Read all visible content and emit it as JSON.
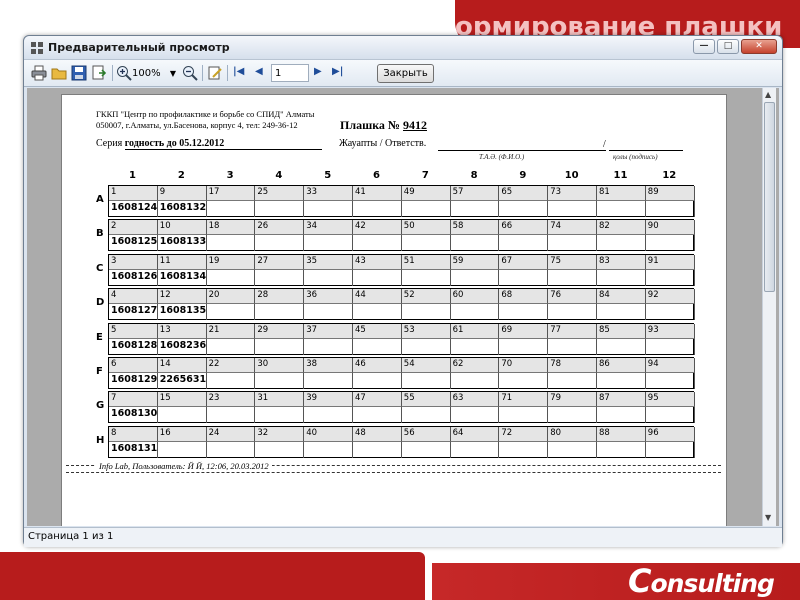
{
  "slide": {
    "header_text": "ормирование плашки",
    "logo_letter": "C",
    "logo_text": "onsulting"
  },
  "window": {
    "title": "Предварительный просмотр",
    "minimize_symbol": "—",
    "maximize_symbol": "□",
    "close_symbol": "✕"
  },
  "toolbar": {
    "zoom": "100%",
    "page_value": "1",
    "close_label": "Закрыть"
  },
  "status": {
    "text": "Страница 1 из 1"
  },
  "report": {
    "org_line1": "ГККП \"Центр по профилактике и борьбе со СПИД\" Алматы",
    "org_line2": "050007, г.Алматы, ул.Басенова, корпус 4, тел: 249-36-12",
    "plate_label": "Плашка №",
    "plate_number": "9412",
    "series_label": "Серия",
    "series_value": "годность до 05.12.2012",
    "responsible_label": "Жауапты / Ответств.",
    "sub_name": "Т.А.Ә. (Ф.И.О.)",
    "sub_sign": "қолы (подпись)",
    "footer": "Info Lab, Пользователь: Й Й, 12:06, 20.03.2012",
    "columns": [
      "1",
      "2",
      "3",
      "4",
      "5",
      "6",
      "7",
      "8",
      "9",
      "10",
      "11",
      "12"
    ],
    "rows": [
      {
        "label": "A",
        "nums": [
          "1",
          "9",
          "17",
          "25",
          "33",
          "41",
          "49",
          "57",
          "65",
          "73",
          "81",
          "89"
        ],
        "codes": [
          "1608124",
          "1608132",
          "",
          "",
          "",
          "",
          "",
          "",
          "",
          "",
          "",
          ""
        ]
      },
      {
        "label": "B",
        "nums": [
          "2",
          "10",
          "18",
          "26",
          "34",
          "42",
          "50",
          "58",
          "66",
          "74",
          "82",
          "90"
        ],
        "codes": [
          "1608125",
          "1608133",
          "",
          "",
          "",
          "",
          "",
          "",
          "",
          "",
          "",
          ""
        ]
      },
      {
        "label": "C",
        "nums": [
          "3",
          "11",
          "19",
          "27",
          "35",
          "43",
          "51",
          "59",
          "67",
          "75",
          "83",
          "91"
        ],
        "codes": [
          "1608126",
          "1608134",
          "",
          "",
          "",
          "",
          "",
          "",
          "",
          "",
          "",
          ""
        ]
      },
      {
        "label": "D",
        "nums": [
          "4",
          "12",
          "20",
          "28",
          "36",
          "44",
          "52",
          "60",
          "68",
          "76",
          "84",
          "92"
        ],
        "codes": [
          "1608127",
          "1608135",
          "",
          "",
          "",
          "",
          "",
          "",
          "",
          "",
          "",
          ""
        ]
      },
      {
        "label": "E",
        "nums": [
          "5",
          "13",
          "21",
          "29",
          "37",
          "45",
          "53",
          "61",
          "69",
          "77",
          "85",
          "93"
        ],
        "codes": [
          "1608128",
          "1608236",
          "",
          "",
          "",
          "",
          "",
          "",
          "",
          "",
          "",
          ""
        ]
      },
      {
        "label": "F",
        "nums": [
          "6",
          "14",
          "22",
          "30",
          "38",
          "46",
          "54",
          "62",
          "70",
          "78",
          "86",
          "94"
        ],
        "codes": [
          "1608129",
          "2265631",
          "",
          "",
          "",
          "",
          "",
          "",
          "",
          "",
          "",
          ""
        ]
      },
      {
        "label": "G",
        "nums": [
          "7",
          "15",
          "23",
          "31",
          "39",
          "47",
          "55",
          "63",
          "71",
          "79",
          "87",
          "95"
        ],
        "codes": [
          "1608130",
          "",
          "",
          "",
          "",
          "",
          "",
          "",
          "",
          "",
          "",
          ""
        ]
      },
      {
        "label": "H",
        "nums": [
          "8",
          "16",
          "24",
          "32",
          "40",
          "48",
          "56",
          "64",
          "72",
          "80",
          "88",
          "96"
        ],
        "codes": [
          "1608131",
          "",
          "",
          "",
          "",
          "",
          "",
          "",
          "",
          "",
          "",
          ""
        ]
      }
    ]
  }
}
